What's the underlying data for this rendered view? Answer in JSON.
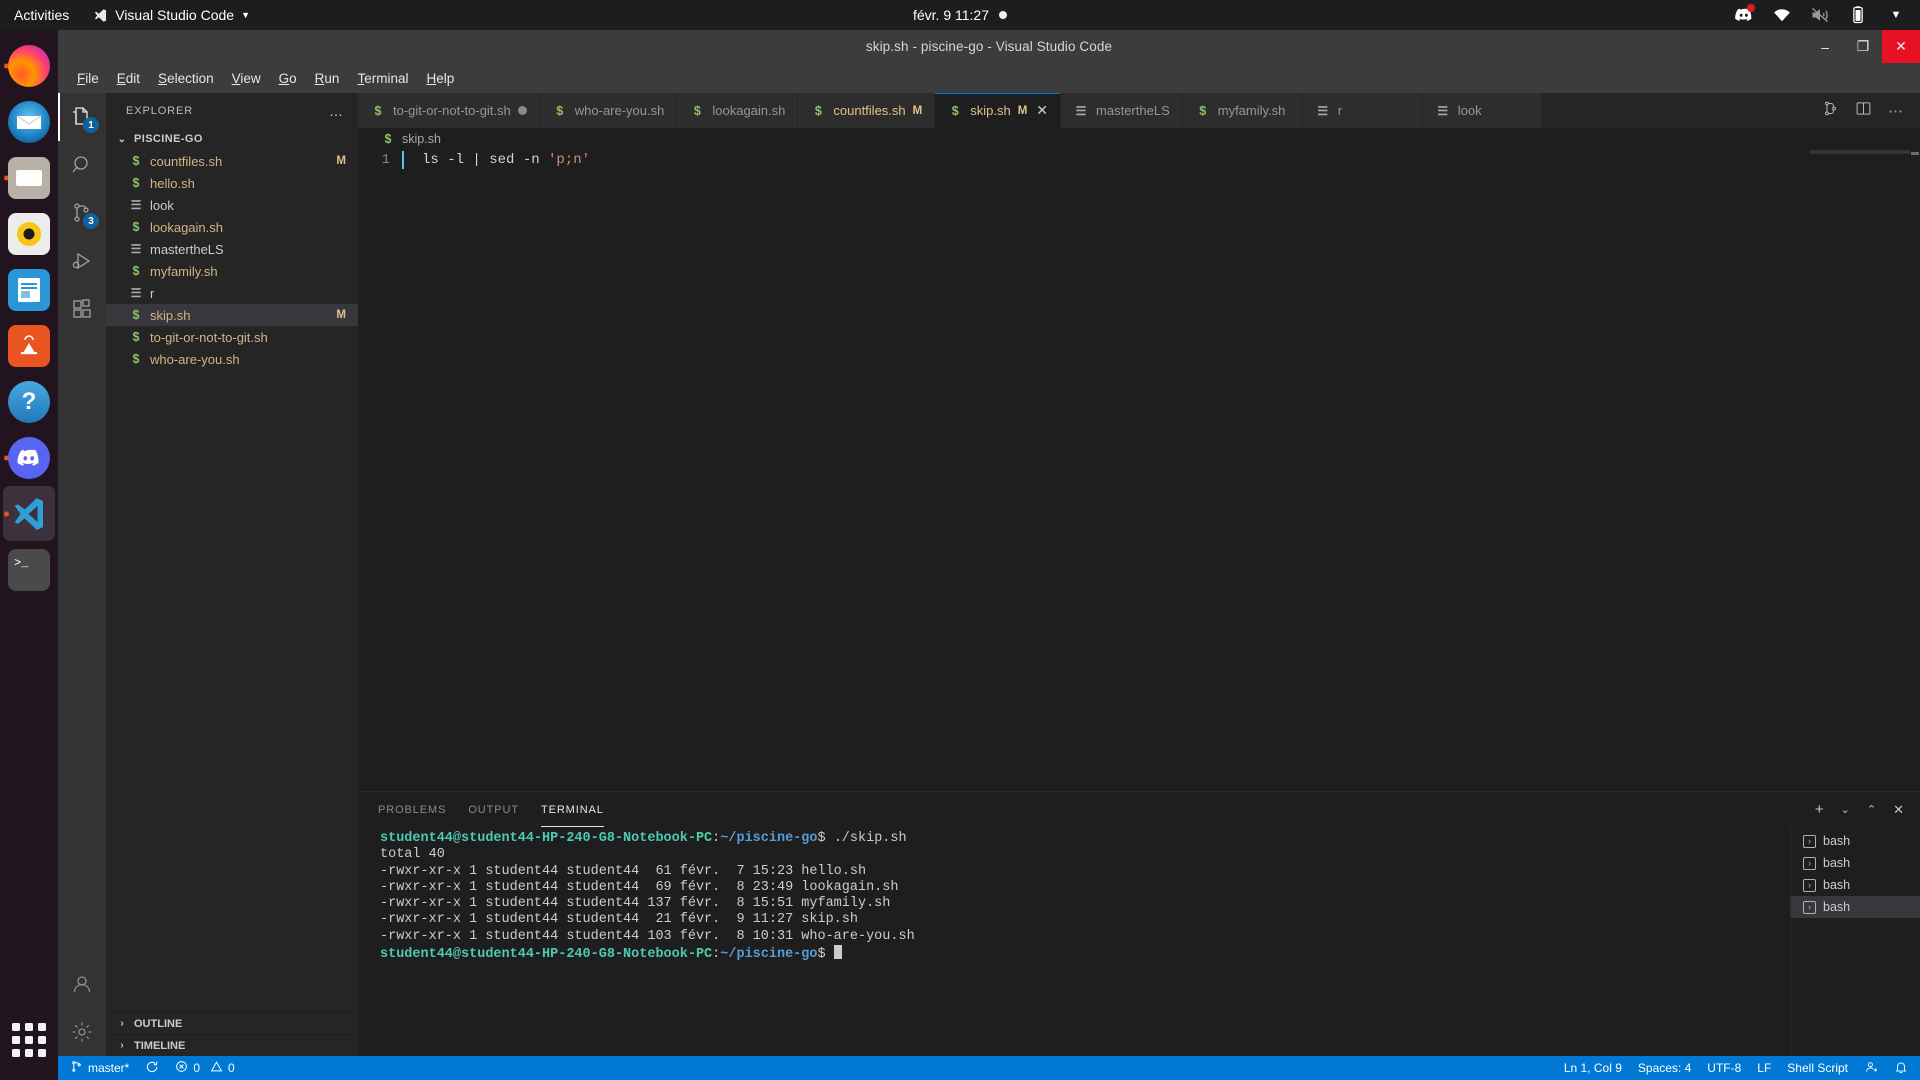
{
  "desktop": {
    "activities": "Activities",
    "app_menu": "Visual Studio Code",
    "clock": "févr. 9  11:27",
    "tray_icons": [
      "discord-icon",
      "wifi-icon",
      "volume-muted-icon",
      "battery-icon",
      "chevron-down-icon"
    ]
  },
  "dock": {
    "items": [
      {
        "name": "firefox",
        "running": true,
        "active": false
      },
      {
        "name": "thunderbird",
        "running": false,
        "active": false
      },
      {
        "name": "files",
        "running": true,
        "active": false
      },
      {
        "name": "rhythmbox",
        "running": false,
        "active": false
      },
      {
        "name": "libreoffice-writer",
        "running": false,
        "active": false
      },
      {
        "name": "ubuntu-software",
        "running": false,
        "active": false
      },
      {
        "name": "help",
        "running": false,
        "active": false
      },
      {
        "name": "discord",
        "running": true,
        "active": false
      },
      {
        "name": "visual-studio-code",
        "running": true,
        "active": true
      },
      {
        "name": "terminal",
        "running": false,
        "active": false
      }
    ],
    "show_apps": "show-applications"
  },
  "window": {
    "title": "skip.sh - piscine-go - Visual Studio Code",
    "minimize": "–",
    "maximize": "❐",
    "close": "✕"
  },
  "menubar": {
    "items": [
      {
        "pre": "",
        "key": "F",
        "post": "ile"
      },
      {
        "pre": "",
        "key": "E",
        "post": "dit"
      },
      {
        "pre": "",
        "key": "S",
        "post": "election"
      },
      {
        "pre": "",
        "key": "V",
        "post": "iew"
      },
      {
        "pre": "",
        "key": "G",
        "post": "o"
      },
      {
        "pre": "",
        "key": "R",
        "post": "un"
      },
      {
        "pre": "",
        "key": "T",
        "post": "erminal"
      },
      {
        "pre": "",
        "key": "H",
        "post": "elp"
      }
    ]
  },
  "activitybar": {
    "items": [
      {
        "name": "explorer",
        "badge": "1",
        "active": true
      },
      {
        "name": "search",
        "badge": "",
        "active": false
      },
      {
        "name": "source-control",
        "badge": "3",
        "active": false
      },
      {
        "name": "run-and-debug",
        "badge": "",
        "active": false
      },
      {
        "name": "extensions",
        "badge": "",
        "active": false
      }
    ],
    "accounts": "accounts",
    "settings": "manage-settings"
  },
  "sidebar": {
    "title": "EXPLORER",
    "more_actions": "…",
    "root_folder": "PISCINE-GO",
    "files": [
      {
        "name": "countfiles.sh",
        "icon": "sh",
        "status": "M"
      },
      {
        "name": "hello.sh",
        "icon": "sh",
        "status": ""
      },
      {
        "name": "look",
        "icon": "txt",
        "status": ""
      },
      {
        "name": "lookagain.sh",
        "icon": "sh",
        "status": ""
      },
      {
        "name": "mastertheLS",
        "icon": "txt",
        "status": ""
      },
      {
        "name": "myfamily.sh",
        "icon": "sh",
        "status": ""
      },
      {
        "name": "r",
        "icon": "txt",
        "status": ""
      },
      {
        "name": "skip.sh",
        "icon": "sh",
        "status": "M",
        "selected": true
      },
      {
        "name": "to-git-or-not-to-git.sh",
        "icon": "sh",
        "status": ""
      },
      {
        "name": "who-are-you.sh",
        "icon": "sh",
        "status": ""
      }
    ],
    "outline": "OUTLINE",
    "timeline": "TIMELINE"
  },
  "tabs": [
    {
      "label": "to-git-or-not-to-git.sh",
      "icon": "sh",
      "state": "dirty",
      "active": false
    },
    {
      "label": "who-are-you.sh",
      "icon": "sh",
      "state": "",
      "active": false
    },
    {
      "label": "lookagain.sh",
      "icon": "sh",
      "state": "",
      "active": false
    },
    {
      "label": "countfiles.sh",
      "icon": "sh",
      "state": "M",
      "active": false
    },
    {
      "label": "skip.sh",
      "icon": "sh",
      "state": "M",
      "active": true
    },
    {
      "label": "mastertheLS",
      "icon": "txt",
      "state": "",
      "active": false
    },
    {
      "label": "myfamily.sh",
      "icon": "sh",
      "state": "",
      "active": false
    },
    {
      "label": "r",
      "icon": "txt",
      "state": "",
      "active": false
    },
    {
      "label": "look",
      "icon": "txt",
      "state": "",
      "active": false
    }
  ],
  "editor": {
    "breadcrumb": "skip.sh",
    "breadcrumb_icon": "sh-file-icon",
    "line_number": "1",
    "code_prefix": "ls -l | sed -n ",
    "code_string": "'p;n'",
    "actions": [
      "split-editor-icon",
      "open-changes-icon",
      "more-actions-icon"
    ]
  },
  "panel": {
    "tabs": [
      {
        "label": "PROBLEMS",
        "active": false
      },
      {
        "label": "OUTPUT",
        "active": false
      },
      {
        "label": "TERMINAL",
        "active": true
      }
    ],
    "actions": [
      "new-terminal-icon",
      "chevron-down-icon",
      "maximize-panel-icon",
      "close-panel-icon"
    ],
    "terminal": {
      "prompt_user": "student44@student44-HP-240-G8-Notebook-PC",
      "prompt_colon": ":",
      "prompt_path": "~/piscine-go",
      "prompt_sign": "$",
      "command": " ./skip.sh",
      "output": [
        "total 40",
        "-rwxr-xr-x 1 student44 student44  61 févr.  7 15:23 hello.sh",
        "-rwxr-xr-x 1 student44 student44  69 févr.  8 23:49 lookagain.sh",
        "-rwxr-xr-x 1 student44 student44 137 févr.  8 15:51 myfamily.sh",
        "-rwxr-xr-x 1 student44 student44  21 févr.  9 11:27 skip.sh",
        "-rwxr-xr-x 1 student44 student44 103 févr.  8 10:31 who-are-you.sh"
      ]
    },
    "terminal_list": [
      {
        "label": "bash",
        "active": false
      },
      {
        "label": "bash",
        "active": false
      },
      {
        "label": "bash",
        "active": false
      },
      {
        "label": "bash",
        "active": true
      }
    ]
  },
  "statusbar": {
    "branch": "master*",
    "sync": "sync-icon",
    "errors": "0",
    "warnings": "0",
    "position": "Ln 1, Col 9",
    "indent": "Spaces: 4",
    "encoding": "UTF-8",
    "eol": "LF",
    "language": "Shell Script",
    "feedback": "feedback-icon",
    "bell": "notifications-icon"
  },
  "colors": {
    "accent": "#0078d4",
    "status_modified": "#e2c08d",
    "shell_icon": "#8cc265",
    "terminal_user": "#4ec9b0",
    "terminal_path": "#569cd6",
    "string": "#ce9178",
    "ubuntu_orange": "#e95420"
  }
}
